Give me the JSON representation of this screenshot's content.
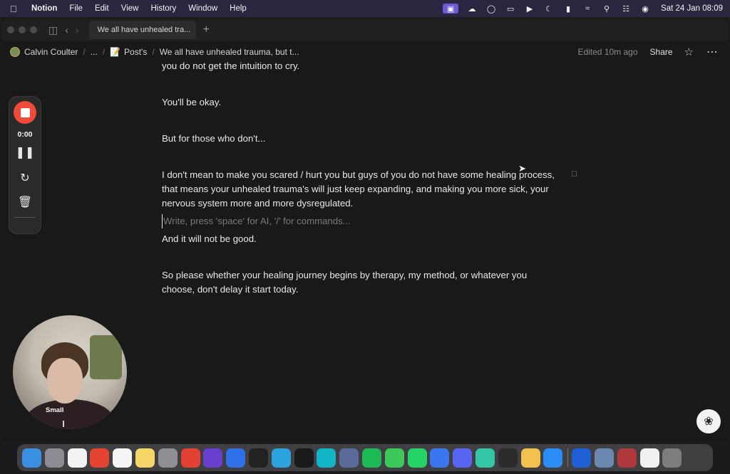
{
  "menubar": {
    "app_name": "Notion",
    "items": [
      "File",
      "Edit",
      "View",
      "History",
      "Window",
      "Help"
    ],
    "datetime": "Sat 24 Jan  08:09"
  },
  "tab": {
    "title": "We all have unhealed tra..."
  },
  "breadcrumb": {
    "workspace": "Calvin Coulter",
    "ellipsis": "...",
    "parent": "Post's",
    "page": "We all have unhealed trauma, but t..."
  },
  "topbar": {
    "edited": "Edited 10m ago",
    "share": "Share"
  },
  "document": {
    "paragraphs": [
      "you do not get the intuition to cry.",
      "You'll be okay.",
      "But for those who don't...",
      "I don't mean to make you scared / hurt you but guys of you do not have some healing process, that means your unhealed trauma's will just keep expanding, and making you more sick, your nervous system more and more dysregulated.",
      "Write, press 'space' for AI, '/' for commands...",
      "And it will not be good.",
      "So please whether your healing journey begins by therapy, my method, or whatever you choose, don't delay it start today."
    ]
  },
  "recorder": {
    "time": "0:00"
  },
  "camera": {
    "label": "Small"
  },
  "dock": {
    "apps": [
      {
        "name": "finder",
        "color": "#3b8fe0"
      },
      {
        "name": "launchpad",
        "color": "#8c8c95"
      },
      {
        "name": "notion",
        "color": "#f2f2f2"
      },
      {
        "name": "todoist",
        "color": "#e44332"
      },
      {
        "name": "reminders",
        "color": "#f5f5f5"
      },
      {
        "name": "notes",
        "color": "#f5d565"
      },
      {
        "name": "system-settings",
        "color": "#8e8e93"
      },
      {
        "name": "chrome",
        "color": "#e34133"
      },
      {
        "name": "arc",
        "color": "#6a3fd0"
      },
      {
        "name": "perplexity",
        "color": "#2f6fea"
      },
      {
        "name": "voice-memos",
        "color": "#222222"
      },
      {
        "name": "telegram",
        "color": "#2aa3df"
      },
      {
        "name": "capcut",
        "color": "#1a1a1a"
      },
      {
        "name": "canva",
        "color": "#12b4c7"
      },
      {
        "name": "chatgpt-eye",
        "color": "#5a6b9a"
      },
      {
        "name": "spotify",
        "color": "#1db954"
      },
      {
        "name": "messages",
        "color": "#3cc85a"
      },
      {
        "name": "whatsapp",
        "color": "#25d366"
      },
      {
        "name": "signal",
        "color": "#3a76f0"
      },
      {
        "name": "discord",
        "color": "#5865f2"
      },
      {
        "name": "cursor-app",
        "color": "#35c6a8"
      },
      {
        "name": "chatgpt",
        "color": "#2b2b2b"
      },
      {
        "name": "photos",
        "color": "#f2c14e"
      },
      {
        "name": "app-store",
        "color": "#2b8cf5"
      },
      {
        "name": "clipper",
        "color": "#1f5fd6"
      },
      {
        "name": "preview",
        "color": "#6a88b0"
      },
      {
        "name": "dictionary",
        "color": "#b0383c"
      },
      {
        "name": "clock",
        "color": "#f0f0f0"
      },
      {
        "name": "trash",
        "color": "#7d7d80"
      }
    ]
  }
}
